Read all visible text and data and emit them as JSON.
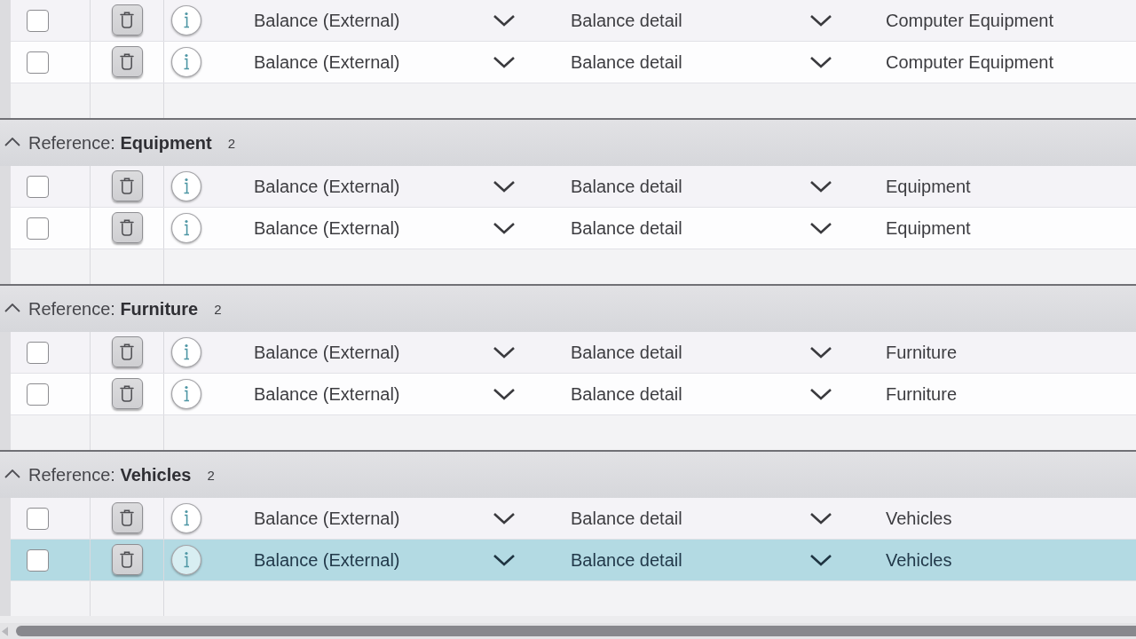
{
  "groups": [
    {
      "rows": [
        {
          "checked": false,
          "selected": false,
          "column_4": "Balance (External)",
          "column_5": "Balance detail",
          "reference": "Computer Equipment"
        },
        {
          "checked": false,
          "selected": false,
          "column_4": "Balance (External)",
          "column_5": "Balance detail",
          "reference": "Computer Equipment"
        }
      ]
    },
    {
      "header": {
        "title": "Reference: **Equipment**",
        "count": "2",
        "expanded": true
      },
      "rows": [
        {
          "checked": false,
          "selected": false,
          "column_4": "Balance (External)",
          "column_5": "Balance detail",
          "reference": "Equipment"
        },
        {
          "checked": false,
          "selected": false,
          "column_4": "Balance (External)",
          "column_5": "Balance detail",
          "reference": "Equipment"
        }
      ]
    },
    {
      "header": {
        "title": "Reference: **Furniture**",
        "count": "2",
        "expanded": true
      },
      "rows": [
        {
          "checked": false,
          "selected": false,
          "column_4": "Balance (External)",
          "column_5": "Balance detail",
          "reference": "Furniture"
        },
        {
          "checked": false,
          "selected": false,
          "column_4": "Balance (External)",
          "column_5": "Balance detail",
          "reference": "Furniture"
        }
      ]
    },
    {
      "header": {
        "title": "Reference: **Vehicles**",
        "count": "2",
        "expanded": true
      },
      "rows": [
        {
          "checked": false,
          "selected": false,
          "column_4": "Balance (External)",
          "column_5": "Balance detail",
          "reference": "Vehicles"
        },
        {
          "checked": false,
          "selected": true,
          "column_4": "Balance (External)",
          "column_5": "Balance detail",
          "reference": "Vehicles"
        }
      ]
    }
  ]
}
